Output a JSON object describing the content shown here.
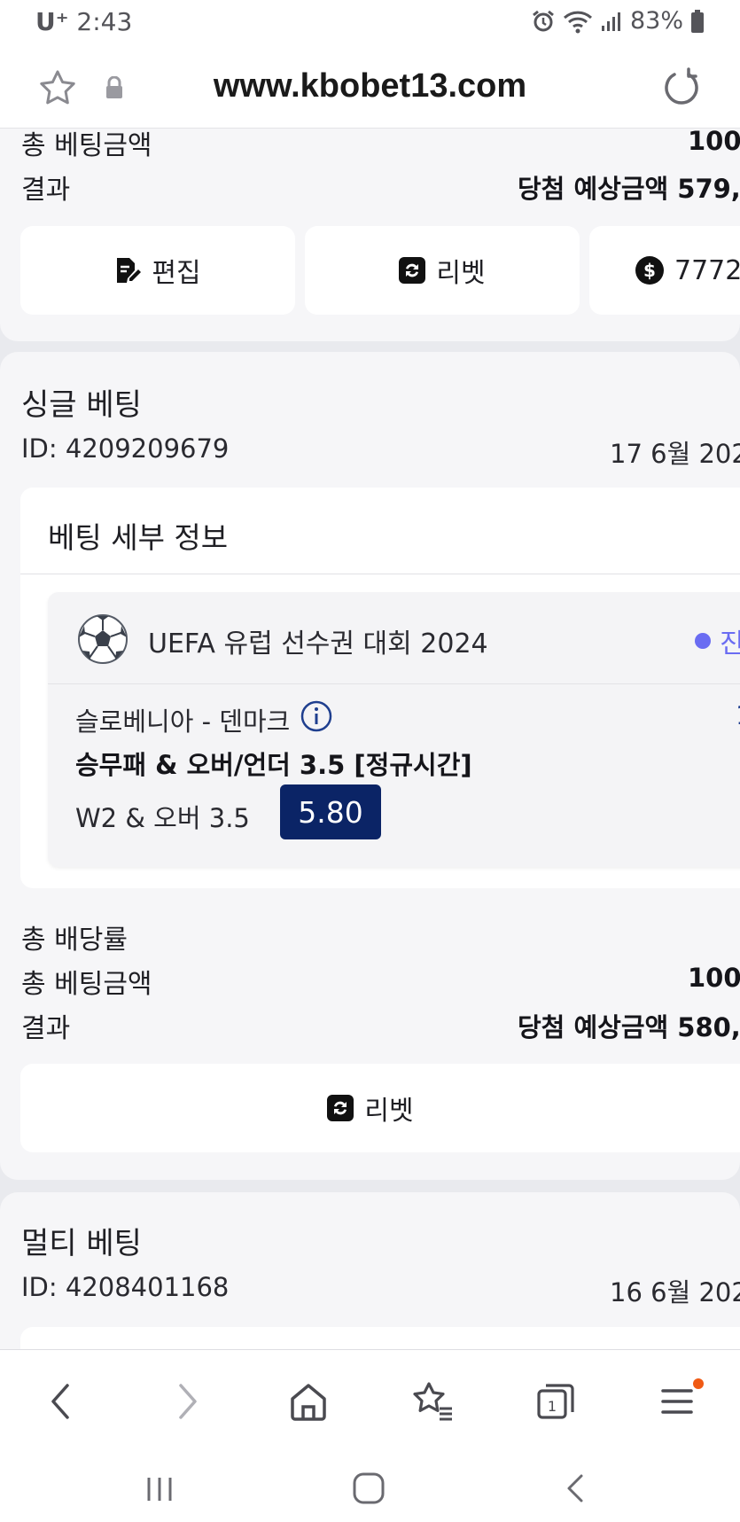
{
  "status_bar": {
    "carrier": "U⁺",
    "time": "2:43",
    "battery": "83%"
  },
  "url_bar": {
    "url": "www.kbobet13.com"
  },
  "top_card": {
    "total_stake_label": "총 베팅금액",
    "total_stake_value": "100,",
    "result_label": "결과",
    "result_value": "당첨 예상금액 579,",
    "buttons": {
      "edit": "편집",
      "rebet": "리벳",
      "cashout": "7772"
    }
  },
  "single_bet": {
    "title": "싱글 베팅",
    "id": "ID: 4209209679",
    "date": "17 6월 202",
    "details_title": "베팅 세부 정보",
    "event": {
      "league": "UEFA 유럽 선수권 대회 2024",
      "status": "진",
      "match": "슬로베니아 - 덴마크",
      "match_side": "1",
      "market": "승무패 & 오버/언더 3.5 [정규시간]",
      "selection": "W2 & 오버 3.5",
      "odds": "5.80"
    },
    "total_odds_label": "총 배당률",
    "total_stake_label": "총 베팅금액",
    "total_stake_value": "100,",
    "result_label": "결과",
    "result_value": "당첨 예상금액 580,",
    "rebet_button": "리벳"
  },
  "multi_bet": {
    "title": "멀티 베팅",
    "id": "ID: 4208401168",
    "date": "16 6월 202"
  },
  "colors": {
    "odds_badge": "#0b2466",
    "status_dot": "#6a6cf2",
    "info_icon": "#1f3f8f",
    "notification_dot": "#f05a14"
  }
}
